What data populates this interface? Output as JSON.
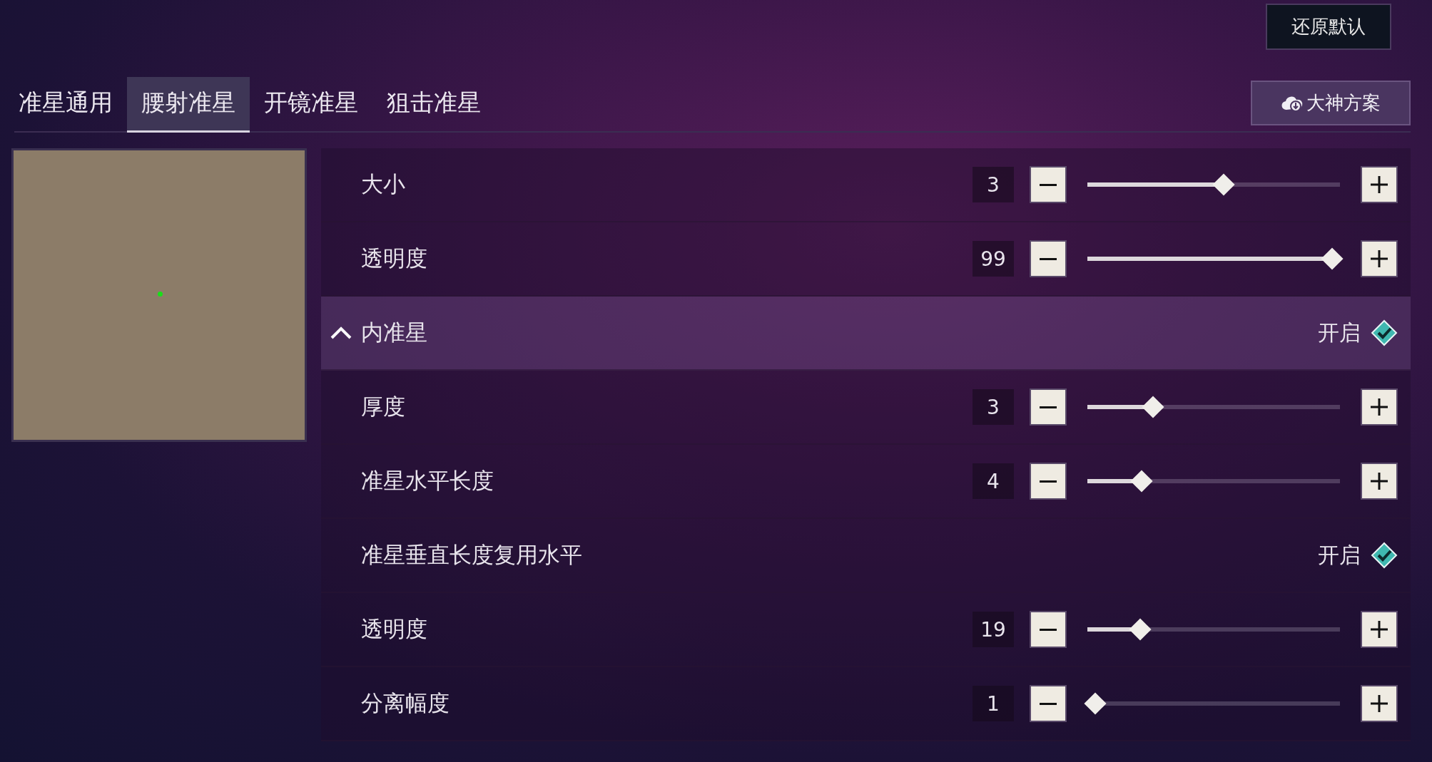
{
  "reset_button": "还原默认",
  "tabs": [
    {
      "label": "准星通用",
      "selected": false
    },
    {
      "label": "腰射准星",
      "selected": true
    },
    {
      "label": "开镜准星",
      "selected": false
    },
    {
      "label": "狙击准星",
      "selected": false
    }
  ],
  "preset_button": "大神方案",
  "rows": [
    {
      "kind": "slider",
      "label": "大小",
      "reading": "3",
      "level": 0.54
    },
    {
      "kind": "slider",
      "label": "透明度",
      "reading": "99",
      "level": 0.97
    },
    {
      "kind": "header",
      "label": "内准星",
      "expanded": true,
      "status": "开启",
      "checked": true
    },
    {
      "kind": "slider",
      "label": "厚度",
      "reading": "3",
      "level": 0.26
    },
    {
      "kind": "slider",
      "label": "准星水平长度",
      "reading": "4",
      "level": 0.215
    },
    {
      "kind": "toggle",
      "label": "准星垂直长度复用水平",
      "status": "开启",
      "checked": true
    },
    {
      "kind": "slider",
      "label": "透明度",
      "reading": "19",
      "level": 0.21
    },
    {
      "kind": "slider",
      "label": "分离幅度",
      "reading": "1",
      "level": 0.03
    }
  ]
}
